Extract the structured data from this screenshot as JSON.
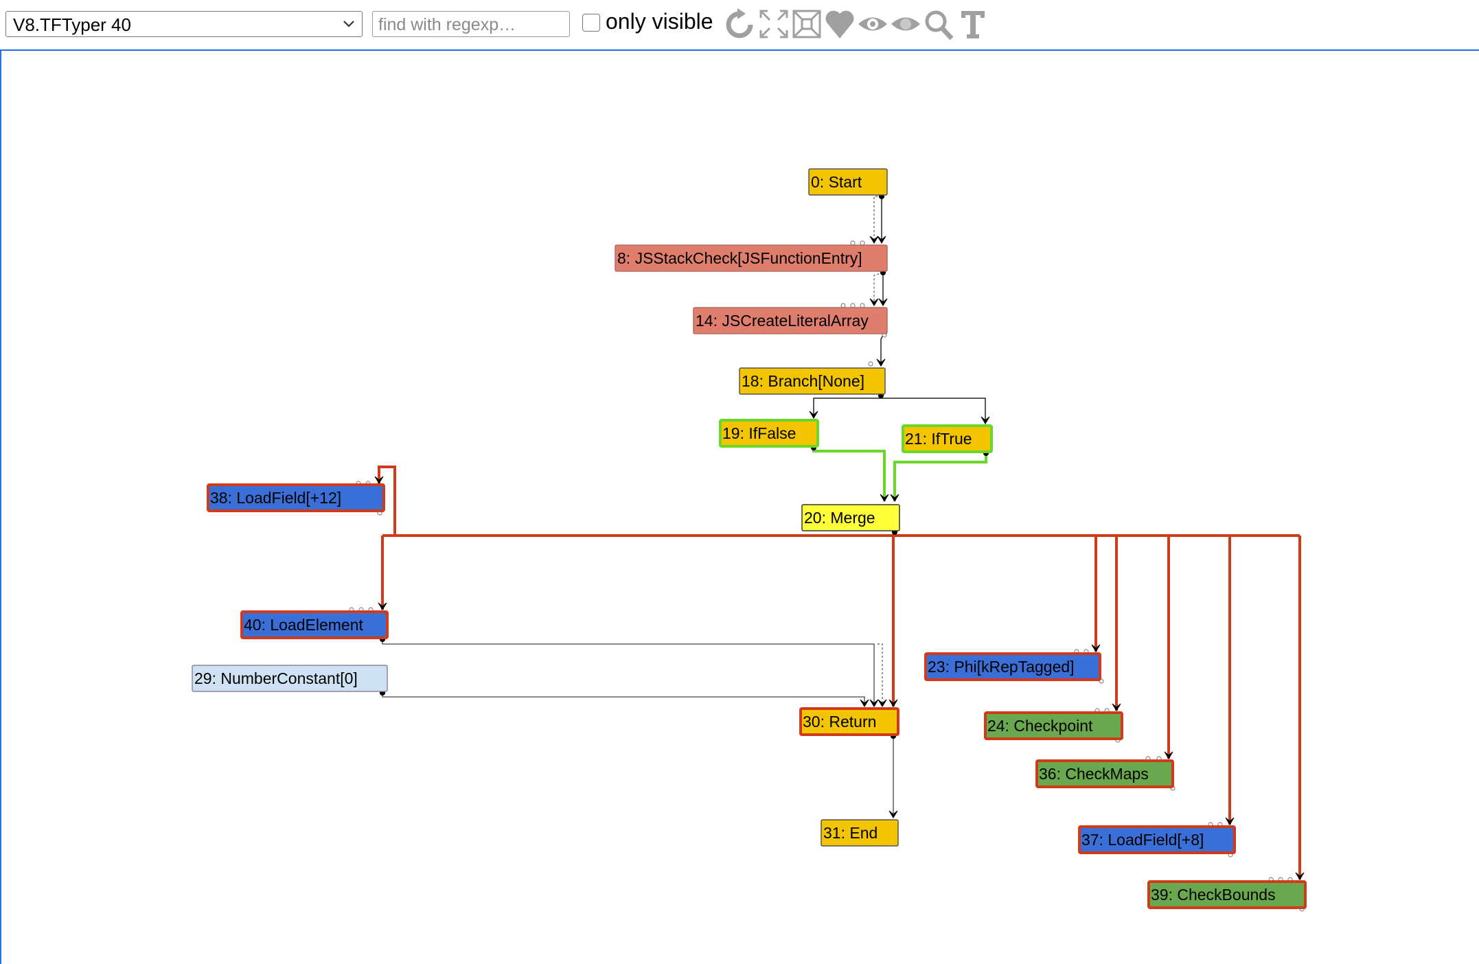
{
  "toolbar": {
    "phase_value": "V8.TFTyper 40",
    "search_placeholder": "find with regexp…",
    "only_visible_label": "only visible",
    "only_visible_checked": false,
    "icons": [
      "reload-icon",
      "expand-icon",
      "fit-icon",
      "heart-icon",
      "eye-icon",
      "eye-hidden-icon",
      "search-icon",
      "type-icon"
    ]
  },
  "colors": {
    "control": "#f2c500",
    "js": "#e07e6e",
    "simplified": "#3b6fd8",
    "machine": "#6aa84f",
    "constant": "#cfe2f3",
    "highlight_red": "#d03c1a",
    "highlight_green": "#6ad82b",
    "selected_merge": "#ffff3a"
  },
  "graph": {
    "nodes": [
      {
        "id": "n0",
        "label": "0: Start"
      },
      {
        "id": "n8",
        "label": "8: JSStackCheck[JSFunctionEntry]"
      },
      {
        "id": "n14",
        "label": "14: JSCreateLiteralArray"
      },
      {
        "id": "n18",
        "label": "18: Branch[None]"
      },
      {
        "id": "n19",
        "label": "19: IfFalse"
      },
      {
        "id": "n21",
        "label": "21: IfTrue"
      },
      {
        "id": "n20",
        "label": "20: Merge"
      },
      {
        "id": "n38",
        "label": "38: LoadField[+12]"
      },
      {
        "id": "n40",
        "label": "40: LoadElement"
      },
      {
        "id": "n29",
        "label": "29: NumberConstant[0]"
      },
      {
        "id": "n30",
        "label": "30: Return"
      },
      {
        "id": "n31",
        "label": "31: End"
      },
      {
        "id": "n23",
        "label": "23: Phi[kRepTagged]"
      },
      {
        "id": "n24",
        "label": "24: Checkpoint"
      },
      {
        "id": "n36",
        "label": "36: CheckMaps"
      },
      {
        "id": "n37",
        "label": "37: LoadField[+8]"
      },
      {
        "id": "n39",
        "label": "39: CheckBounds"
      }
    ]
  }
}
